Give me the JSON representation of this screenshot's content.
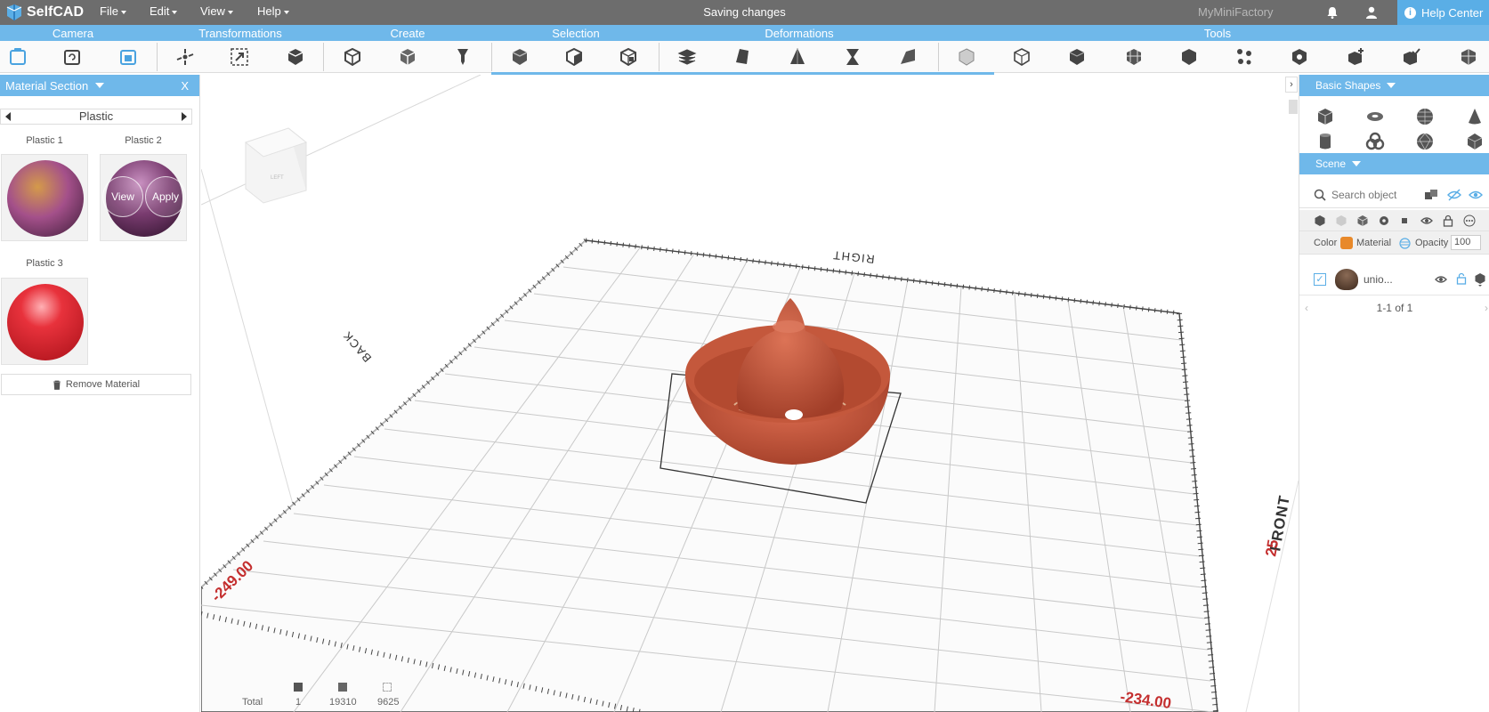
{
  "app": {
    "name": "SelfCAD",
    "status": "Saving changes",
    "brand_link": "MyMiniFactory",
    "help_label": "Help Center"
  },
  "menus": [
    "File",
    "Edit",
    "View",
    "Help"
  ],
  "toolbar_groups": [
    "Camera",
    "Transformations",
    "Create",
    "Selection",
    "Deformations",
    "Tools"
  ],
  "material_panel": {
    "title": "Material Section",
    "close_label": "X",
    "category": "Plastic",
    "items": [
      {
        "label": "Plastic 1"
      },
      {
        "label": "Plastic 2",
        "view_label": "View",
        "apply_label": "Apply"
      },
      {
        "label": "Plastic 3"
      }
    ],
    "remove_label": "Remove Material"
  },
  "viewport": {
    "labels": {
      "right": "RIGHT",
      "back": "BACK",
      "front": "FRONT",
      "cube_left": "LEFT"
    },
    "coords": {
      "left": "-249.00",
      "bottom": "-234.00",
      "right_partial": "25"
    },
    "object_color": "#c4583c"
  },
  "stats": {
    "total_label": "Total",
    "objects": "1",
    "faces": "19310",
    "vertices": "9625"
  },
  "basic_shapes": {
    "title": "Basic Shapes"
  },
  "scene": {
    "title": "Scene",
    "search_placeholder": "Search object",
    "color_label": "Color",
    "material_label": "Material",
    "opacity_label": "Opacity",
    "opacity_value": "100",
    "color_value": "#e8892a",
    "item_name": "unio...",
    "pager": "1-1 of 1"
  },
  "colors": {
    "accent": "#6fb8ea",
    "menubar": "#6d6d6d",
    "help": "#5aaee6"
  }
}
